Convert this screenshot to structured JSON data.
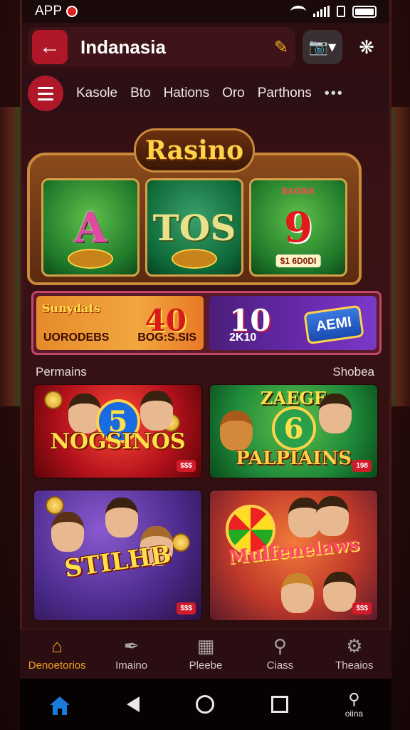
{
  "status_bar": {
    "app_label": "APP",
    "icons": [
      "recording-icon",
      "wifi-icon",
      "signal-icon",
      "lock-icon",
      "battery-icon"
    ]
  },
  "header": {
    "back_icon": "arrow-left-icon",
    "title": "Indanasia",
    "pin_icon": "pin-icon",
    "camera_icon": "camera-icon",
    "bug_icon": "bug-icon"
  },
  "categories": {
    "menu_icon": "hamburger-icon",
    "items": [
      "Kasole",
      "Bto",
      "Hations",
      "Oro",
      "Parthons"
    ],
    "more": "•••"
  },
  "hero": {
    "title": "Rasino",
    "reels": [
      {
        "top": "",
        "symbol": "A",
        "amount": ""
      },
      {
        "top": "",
        "symbol": "TOS",
        "amount": ""
      },
      {
        "top": "BAGINX",
        "symbol": "9",
        "amount": "$1 6D0DI"
      }
    ]
  },
  "promos": [
    {
      "tag": "Sunydats",
      "number": "40",
      "sub_left": "UORODEBS",
      "sub_right": "BOG:S.SIS"
    },
    {
      "number": "10",
      "sub": "2K10",
      "badge": "AEMI"
    }
  ],
  "section": {
    "left": "Permains",
    "right": "Shobea"
  },
  "games": [
    {
      "name": "NOGSINOS",
      "number": "5",
      "badge": "$$$"
    },
    {
      "top": "ZAEGE",
      "name": "PALPIAINS",
      "number": "6",
      "badge": "198"
    },
    {
      "name": "STILHB",
      "badge": "$$$"
    },
    {
      "name": "Mulfenelaws",
      "badge": "$$$"
    }
  ],
  "tabs": [
    {
      "label": "Denoetorios",
      "icon": "home-icon",
      "active": true
    },
    {
      "label": "Imaino",
      "icon": "feather-icon",
      "active": false
    },
    {
      "label": "Pleebe",
      "icon": "calendar-icon",
      "active": false
    },
    {
      "label": "Ciass",
      "icon": "search-icon",
      "active": false
    },
    {
      "label": "Theaios",
      "icon": "gear-icon",
      "active": false
    }
  ],
  "system_nav": {
    "search_label": "oiina"
  },
  "colors": {
    "accent": "#b0182a",
    "active_tab": "#f2a11c",
    "background": "#2a0e10"
  }
}
